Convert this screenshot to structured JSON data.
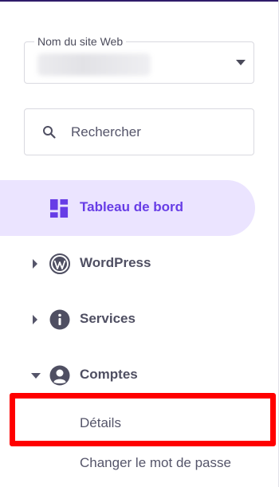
{
  "site_select": {
    "label": "Nom du site Web",
    "value": ""
  },
  "search": {
    "placeholder": "Rechercher"
  },
  "nav": {
    "items": [
      {
        "label": "Tableau de bord",
        "icon": "dashboard-icon",
        "active": true
      },
      {
        "label": "WordPress",
        "icon": "wordpress-icon",
        "expanded": false
      },
      {
        "label": "Services",
        "icon": "info-icon",
        "expanded": false
      },
      {
        "label": "Comptes",
        "icon": "account-icon",
        "expanded": true
      }
    ],
    "sub_items": [
      {
        "label": "Détails",
        "highlighted": true
      },
      {
        "label": "Changer le mot de passe"
      }
    ]
  },
  "colors": {
    "accent": "#673de6",
    "active_bg": "#ebe4ff",
    "text": "#4f4f62",
    "highlight": "#ff0000"
  }
}
